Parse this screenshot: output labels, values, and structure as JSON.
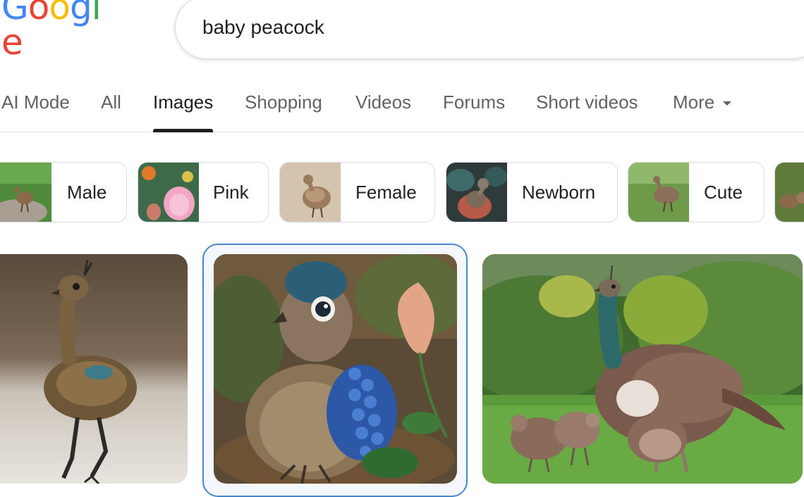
{
  "logo": {
    "letters": [
      {
        "ch": "G",
        "color": "#4285F4"
      },
      {
        "ch": "o",
        "color": "#EA4335"
      },
      {
        "ch": "o",
        "color": "#FBBC05"
      },
      {
        "ch": "g",
        "color": "#4285F4"
      },
      {
        "ch": "l",
        "color": "#34A853"
      },
      {
        "ch": "e",
        "color": "#EA4335"
      }
    ]
  },
  "search": {
    "query": "baby peacock"
  },
  "tabs": [
    {
      "label": "AI Mode"
    },
    {
      "label": "All"
    },
    {
      "label": "Images",
      "active": true
    },
    {
      "label": "Shopping"
    },
    {
      "label": "Videos"
    },
    {
      "label": "Forums"
    },
    {
      "label": "Short videos"
    },
    {
      "label": "More"
    }
  ],
  "chips": [
    {
      "label": "Male"
    },
    {
      "label": "Pink"
    },
    {
      "label": "Female"
    },
    {
      "label": "Newborn"
    },
    {
      "label": "Cute"
    },
    {
      "label": ""
    }
  ],
  "results": [
    {
      "name": "result-image-1"
    },
    {
      "name": "result-image-2",
      "selected": true
    },
    {
      "name": "result-image-3"
    }
  ],
  "colors": {
    "accent": "#4a87c9",
    "text": "#1f1f1f",
    "muted": "#5f6368",
    "border": "#dadce0"
  }
}
